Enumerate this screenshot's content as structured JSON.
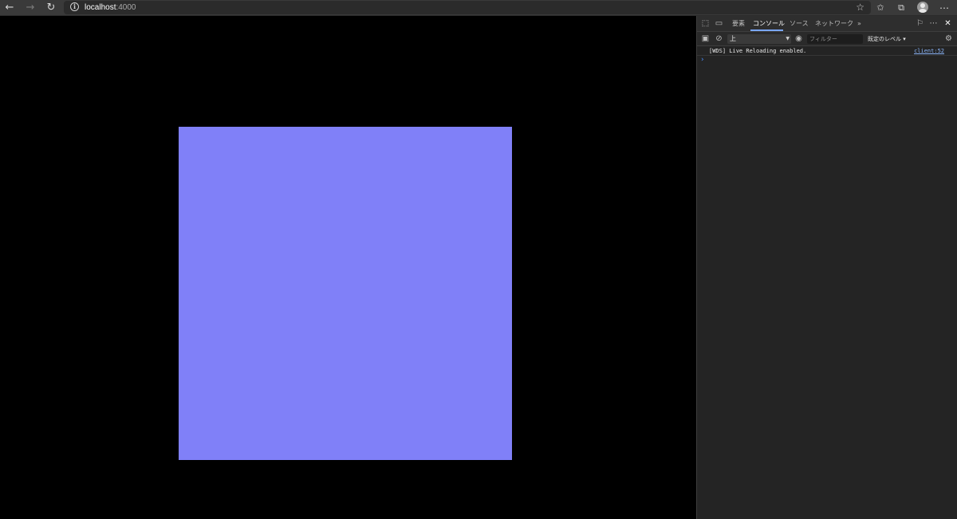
{
  "browser": {
    "url_host": "localhost",
    "url_port": ":4000",
    "icons": {
      "back": "back-arrow-icon",
      "forward": "forward-arrow-icon",
      "reload": "reload-icon",
      "info": "info-icon",
      "favorite": "star-icon",
      "favorites": "favorites-icon",
      "collections": "collections-icon",
      "profile": "avatar",
      "menu": "more-icon"
    }
  },
  "page": {
    "background": "#000000",
    "square_color": "#8080f8"
  },
  "devtools": {
    "tabs": [
      "要素",
      "コンソール",
      "ソース",
      "ネットワーク"
    ],
    "active_tab": "コンソール",
    "more_tabs": "»",
    "context": "上",
    "filter_placeholder": "フィルター",
    "level_label": "既定のレベル ▾",
    "console": {
      "messages": [
        {
          "text": "[WDS] Live Reloading enabled.",
          "source": "client:52"
        }
      ],
      "prompt_symbol": "›"
    }
  }
}
